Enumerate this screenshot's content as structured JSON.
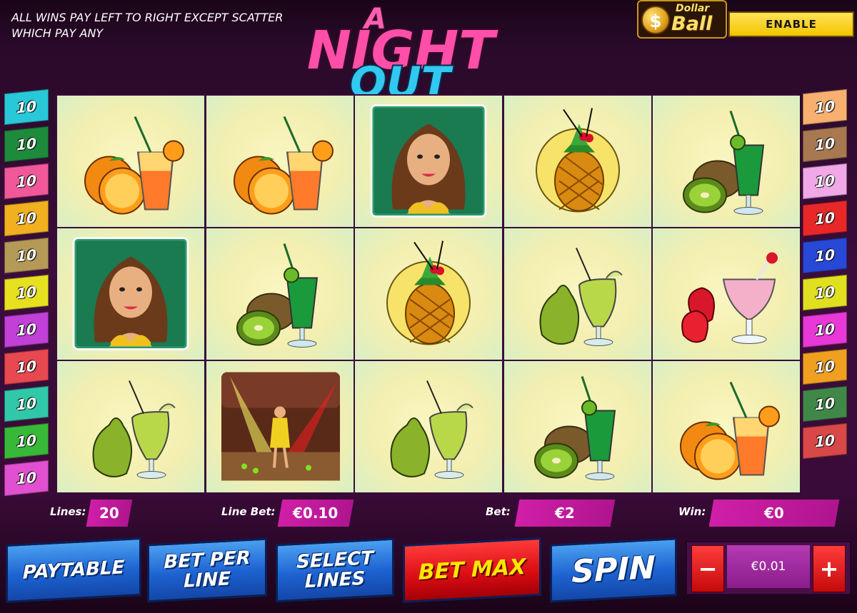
{
  "info": {
    "line1": "ALL WINS PAY LEFT TO RIGHT EXCEPT SCATTER",
    "line2": "WHICH PAY ANY"
  },
  "logo": {
    "line1": "A",
    "line2": "NIGHT",
    "line3": "OUT"
  },
  "dollar_ball": {
    "coin": "$",
    "word1": "Dollar",
    "word2": "Ball",
    "button": "ENABLE"
  },
  "paylines": {
    "left": [
      {
        "label": "10",
        "color": "#28c8d8"
      },
      {
        "label": "10",
        "color": "#1e8a3c"
      },
      {
        "label": "10",
        "color": "#f0589a"
      },
      {
        "label": "10",
        "color": "#f0b020"
      },
      {
        "label": "10",
        "color": "#b49a56"
      },
      {
        "label": "10",
        "color": "#e6e020"
      },
      {
        "label": "10",
        "color": "#c040d8"
      },
      {
        "label": "10",
        "color": "#e84850"
      },
      {
        "label": "10",
        "color": "#30c8a8"
      },
      {
        "label": "10",
        "color": "#38b838"
      },
      {
        "label": "10",
        "color": "#e050d0"
      }
    ],
    "right": [
      {
        "label": "10",
        "color": "#f8b070"
      },
      {
        "label": "10",
        "color": "#a87850"
      },
      {
        "label": "10",
        "color": "#f0a8e8"
      },
      {
        "label": "10",
        "color": "#e82828"
      },
      {
        "label": "10",
        "color": "#2848d8"
      },
      {
        "label": "10",
        "color": "#e0e020"
      },
      {
        "label": "10",
        "color": "#e838d8"
      },
      {
        "label": "10",
        "color": "#f0a020"
      },
      {
        "label": "10",
        "color": "#408848"
      },
      {
        "label": "10",
        "color": "#d84848"
      }
    ]
  },
  "reels": [
    [
      "orange-cocktail",
      "orange-cocktail",
      "woman",
      "pineapple-cocktail",
      "kiwi-cocktail"
    ],
    [
      "woman",
      "kiwi-cocktail",
      "pineapple-cocktail",
      "pear-cocktail",
      "strawberry-cocktail"
    ],
    [
      "pear-cocktail",
      "dancer-scatter",
      "pear-cocktail",
      "kiwi-cocktail",
      "orange-cocktail"
    ]
  ],
  "status": {
    "lines_label": "Lines:",
    "lines_value": "20",
    "line_bet_label": "Line Bet:",
    "line_bet_value": "€0.10",
    "bet_label": "Bet:",
    "bet_value": "€2",
    "win_label": "Win:",
    "win_value": "€0"
  },
  "buttons": {
    "paytable": "PAYTABLE",
    "bet_per_line_1": "BET PER",
    "bet_per_line_2": "LINE",
    "select_lines_1": "SELECT",
    "select_lines_2": "LINES",
    "bet_max": "BET MAX",
    "spin": "SPIN",
    "minus": "−",
    "plus": "+",
    "stake": "€0.01"
  }
}
